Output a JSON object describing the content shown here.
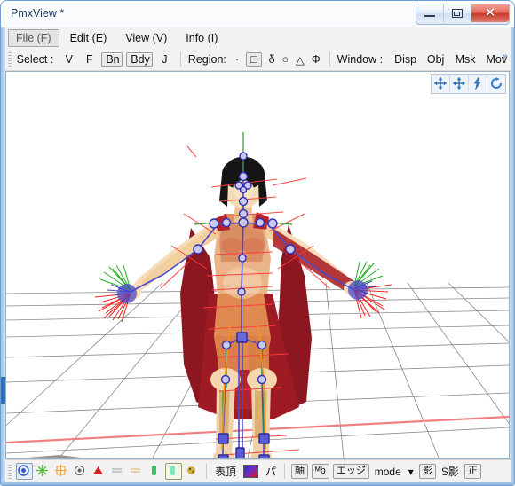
{
  "window": {
    "title": "PmxView *",
    "buttons": {
      "minimize": "minimize-button",
      "maximize": "maximize-button",
      "close": "✕"
    }
  },
  "menubar": {
    "items": [
      {
        "label": "File (F)",
        "active": true
      },
      {
        "label": "Edit (E)",
        "active": false
      },
      {
        "label": "View (V)",
        "active": false
      },
      {
        "label": "Info (I)",
        "active": false
      }
    ]
  },
  "toolbar": {
    "select_label": "Select :",
    "select_buttons": [
      {
        "label": "V",
        "toggled": false
      },
      {
        "label": "F",
        "toggled": false
      },
      {
        "label": "Bn",
        "toggled": true
      },
      {
        "label": "Bdy",
        "toggled": true
      },
      {
        "label": "J",
        "toggled": false
      }
    ],
    "region_label": "Region:",
    "region_symbols": [
      {
        "glyph": "·",
        "boxed": false
      },
      {
        "glyph": "□",
        "boxed": true
      },
      {
        "glyph": "δ",
        "boxed": false
      },
      {
        "glyph": "○",
        "boxed": false
      },
      {
        "glyph": "△",
        "boxed": false
      },
      {
        "glyph": "Φ",
        "boxed": false
      }
    ],
    "window_label": "Window :",
    "window_buttons": [
      "Disp",
      "Obj",
      "Msk",
      "Mov"
    ],
    "overflow": "»"
  },
  "viewport": {
    "gizmos": [
      "pan-gizmo",
      "move-gizmo",
      "zoom-gizmo",
      "rotate-gizmo"
    ],
    "background_color": "#ffffff",
    "grid_color": "#808080",
    "axis_color_x": "#ff6060",
    "axis_color_y": "#20a020",
    "bone_color": "#5a5ad0",
    "ik_color": "#ff3030",
    "shadow_color": "#8a8a8a",
    "model": {
      "skin_color": "#f2d2a8",
      "skin_shade": "#d9a066",
      "dress_color": "#9e1b24",
      "dress_light": "#e08a52",
      "hair_color": "#151515",
      "cape_color": "#a81c26"
    }
  },
  "bottombar": {
    "icons": [
      {
        "name": "vertex-display-icon",
        "framed": true,
        "glyph": "◉",
        "color": "#2b50c8"
      },
      {
        "name": "weight-display-icon",
        "framed": false,
        "glyph": "✳",
        "color": "#57c039"
      },
      {
        "name": "sdef-display-icon",
        "framed": false,
        "glyph": "✸",
        "color": "#e8a33a"
      },
      {
        "name": "point-display-icon",
        "framed": false,
        "glyph": "◉",
        "color": "#666666"
      },
      {
        "name": "face-display-icon",
        "framed": false,
        "glyph": "▲",
        "color": "#d02020"
      },
      {
        "name": "line-display-icon",
        "framed": false,
        "glyph": "≈",
        "color": "#9a9a9a"
      },
      {
        "name": "mesh-display-icon",
        "framed": false,
        "glyph": "≈",
        "color": "#e0b070"
      },
      {
        "name": "bone-display-icon",
        "framed": false,
        "glyph": "▮",
        "color": "#3cc36a"
      },
      {
        "name": "body-display-icon",
        "framed": true,
        "glyph": "▮",
        "color": "#6ee0b0"
      },
      {
        "name": "joint-display-icon",
        "framed": false,
        "glyph": "❁",
        "color": "#c9a227"
      }
    ],
    "label_vertex": "表頂",
    "color_swatch": "material-color-swatch",
    "label_paren": "パ",
    "buttons": [
      {
        "label": "軸",
        "name": "axis-button"
      },
      {
        "label": "ᴹb",
        "name": "mb-button"
      },
      {
        "label": "エッジ゚",
        "name": "edge-button"
      }
    ],
    "mode_label": "mode",
    "mode_caret": "▾",
    "shadow_buttons": [
      {
        "label": "影",
        "name": "shadow-button",
        "framed": true
      },
      {
        "label": "S影",
        "name": "self-shadow-button",
        "framed": false
      },
      {
        "label": "正",
        "name": "ortho-button",
        "framed": true
      }
    ]
  }
}
